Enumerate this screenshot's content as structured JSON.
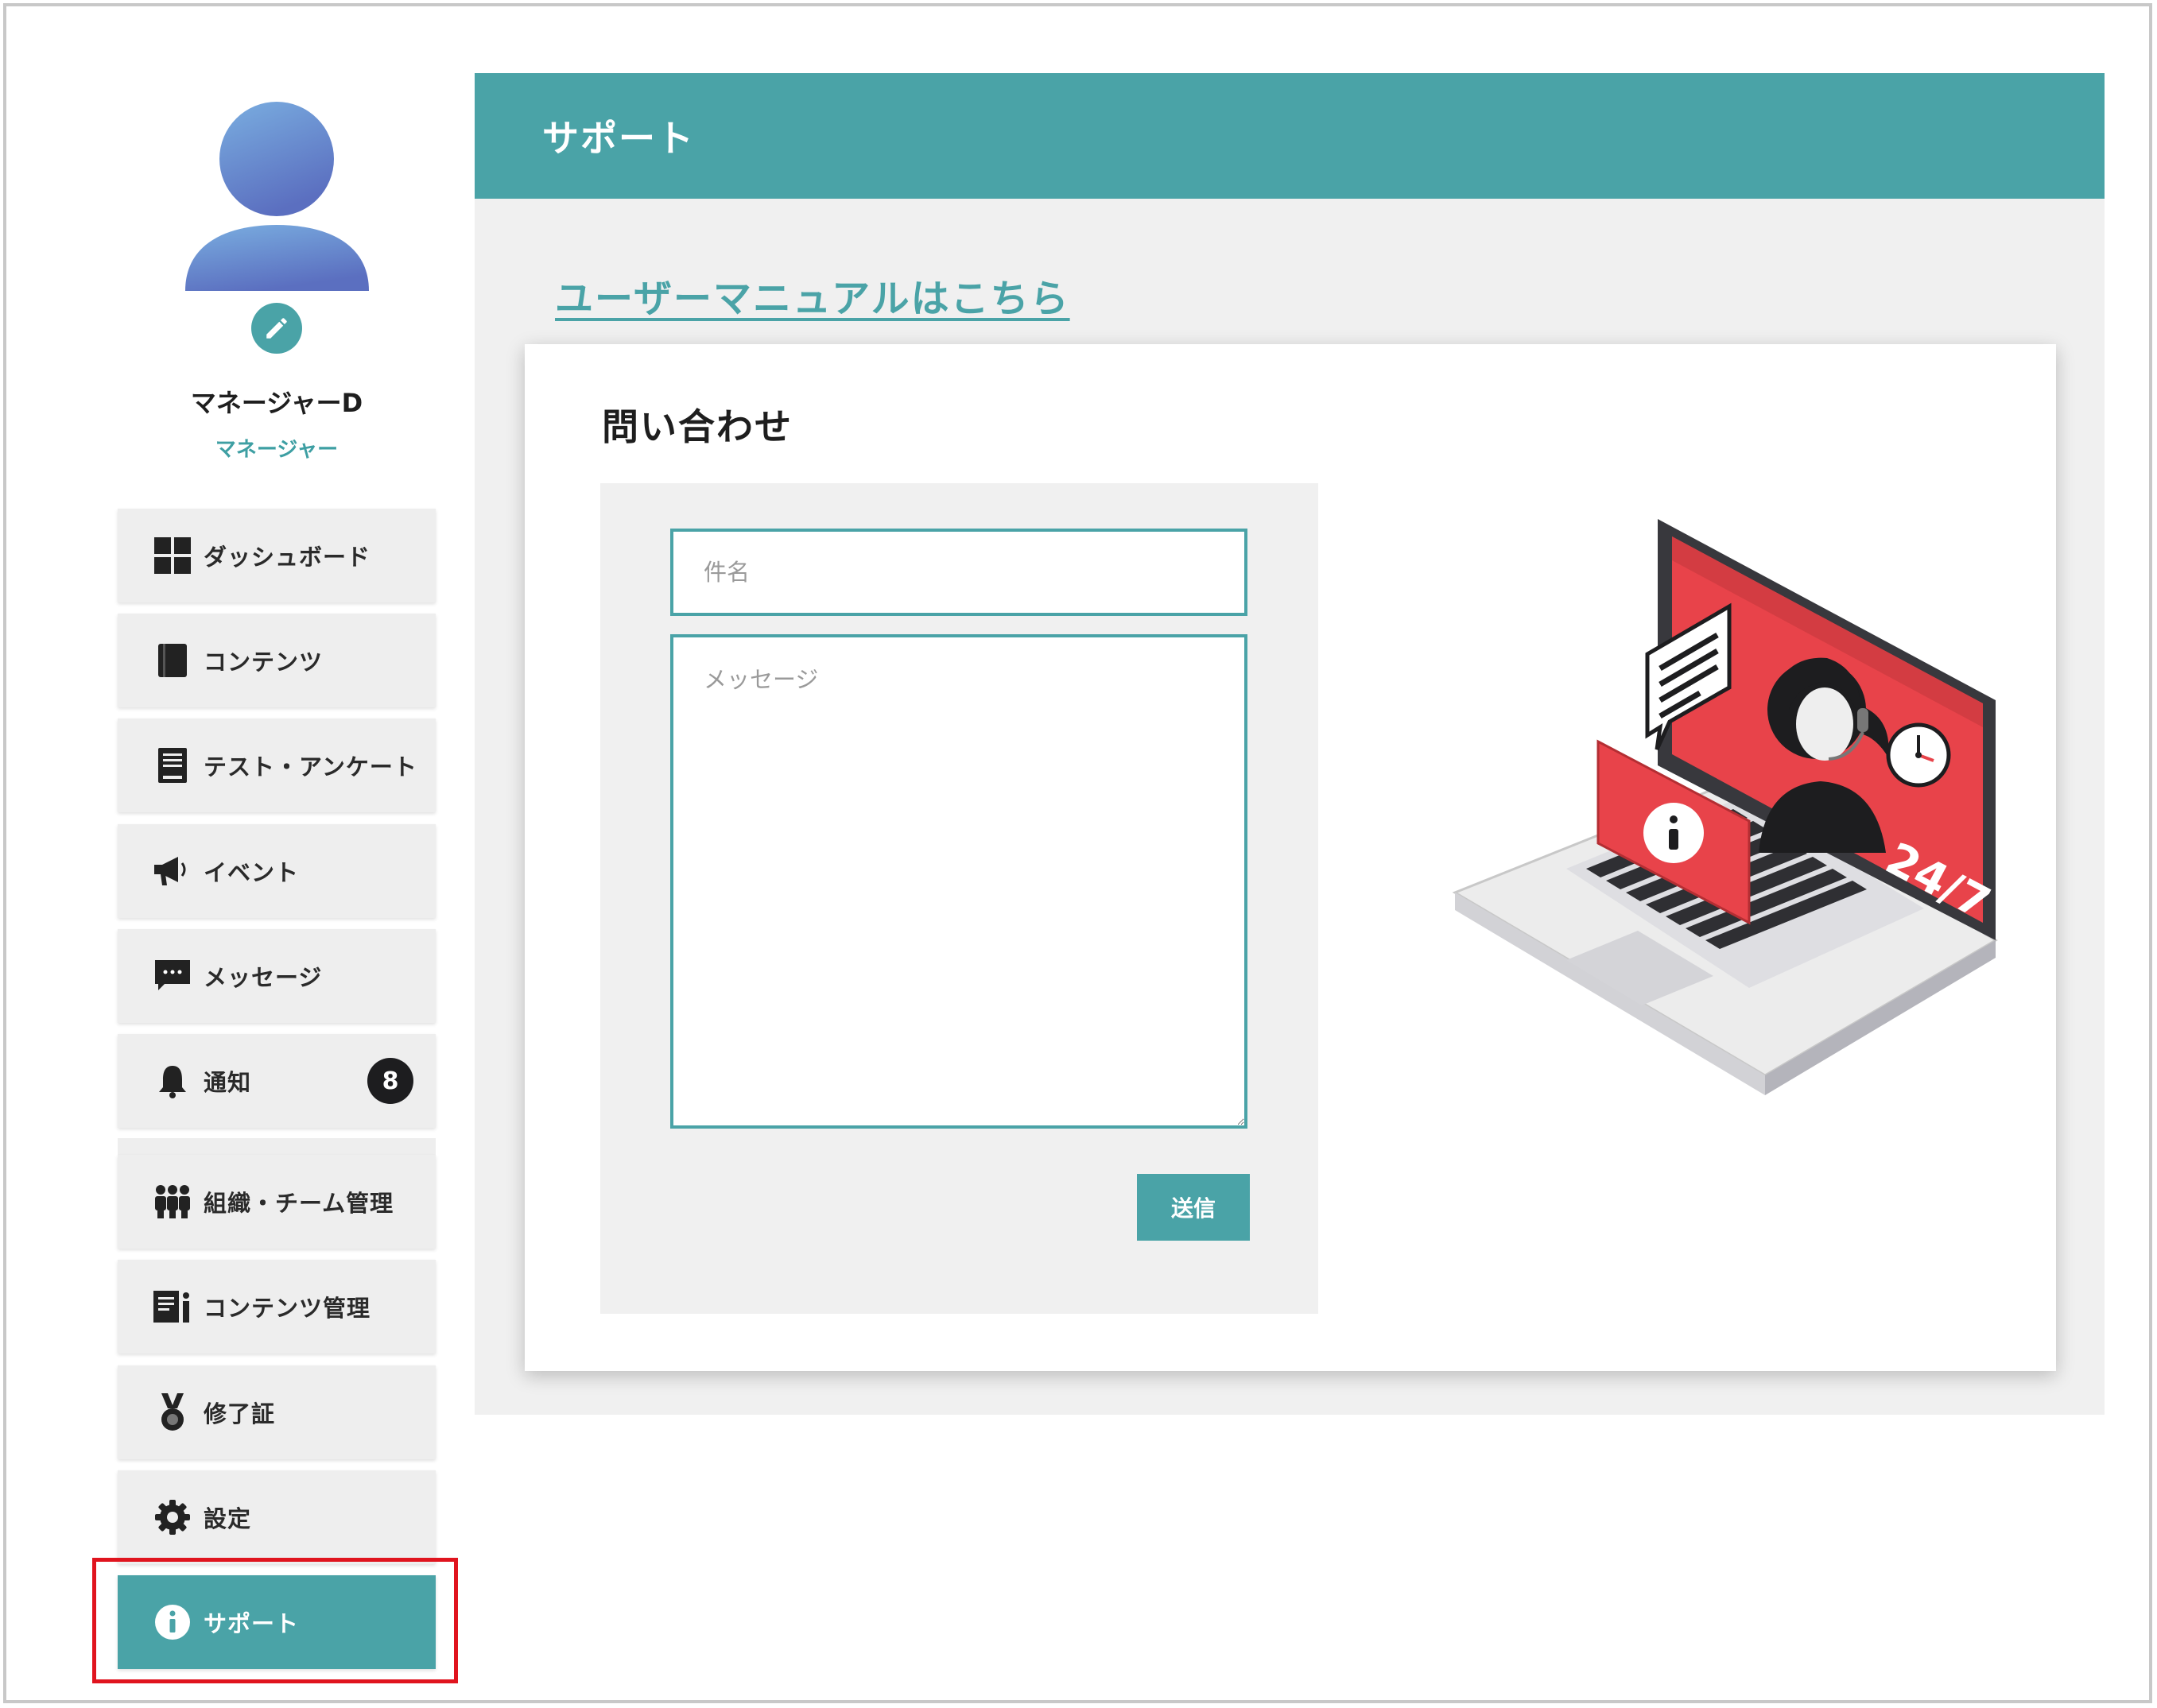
{
  "user": {
    "name": "マネージャーD",
    "role": "マネージャー"
  },
  "sidebar": {
    "items": [
      {
        "label": "ダッシュボード",
        "icon": "dashboard-grid-icon"
      },
      {
        "label": "コンテンツ",
        "icon": "book-icon"
      },
      {
        "label": "テスト・アンケート",
        "icon": "document-icon"
      },
      {
        "label": "イベント",
        "icon": "megaphone-icon"
      },
      {
        "label": "メッセージ",
        "icon": "chat-bubble-icon"
      },
      {
        "label": "通知",
        "icon": "bell-icon",
        "badge": "8"
      },
      {
        "label": "組織・チーム管理",
        "icon": "team-icon"
      },
      {
        "label": "コンテンツ管理",
        "icon": "content-manage-icon"
      },
      {
        "label": "修了証",
        "icon": "medal-icon"
      },
      {
        "label": "設定",
        "icon": "gear-icon"
      },
      {
        "label": "サポート",
        "icon": "info-icon",
        "active": true
      }
    ]
  },
  "header": {
    "title": "サポート"
  },
  "main": {
    "manual_link": "ユーザーマニュアルはこちら",
    "inquiry": {
      "title": "問い合わせ",
      "subject_placeholder": "件名",
      "message_placeholder": "メッセージ",
      "submit_label": "送信"
    },
    "illustration_text": "24/7"
  },
  "colors": {
    "accent": "#4aa3a7",
    "highlight": "#e0141e",
    "illustration_red": "#e8434a"
  }
}
